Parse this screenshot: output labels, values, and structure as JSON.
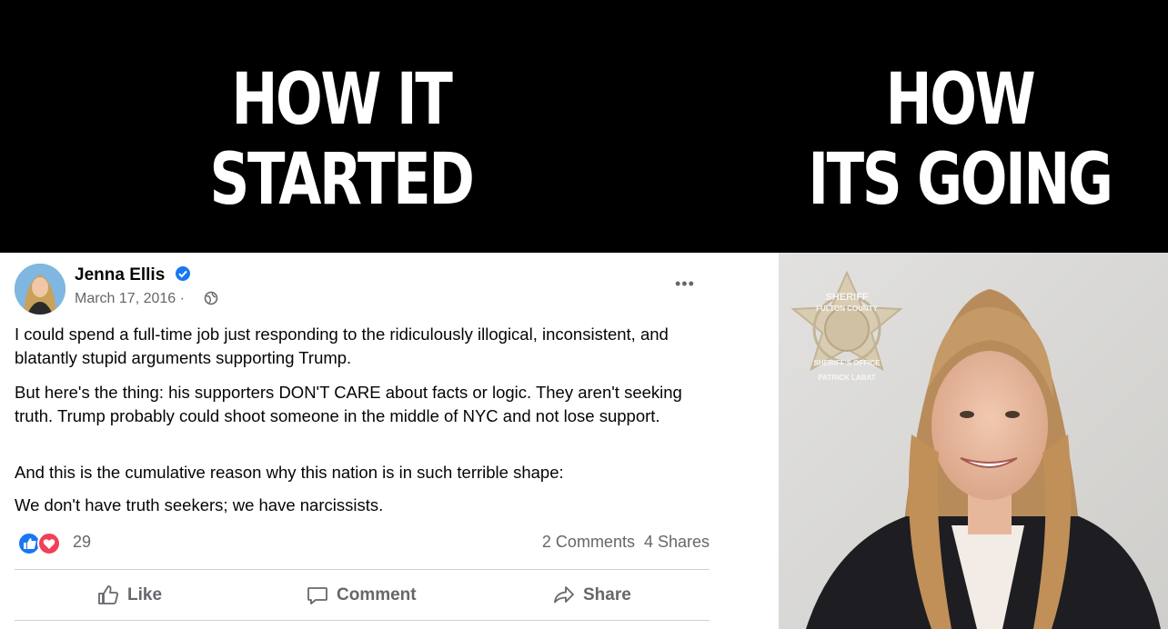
{
  "captions": {
    "left": [
      "HOW IT",
      "STARTED"
    ],
    "right": [
      "HOW",
      "ITS GOING"
    ]
  },
  "post": {
    "author": "Jenna Ellis",
    "date": "March 17, 2016 ·",
    "paragraphs": [
      "I could spend a full-time job just responding to the ridiculously illogical, inconsistent, and blatantly stupid arguments supporting Trump.",
      "But here's the thing: his supporters DON'T CARE about facts or logic. They aren't seeking truth. Trump probably could shoot someone in the middle of NYC and not lose support.",
      "And this is the cumulative reason why this nation is in such terrible shape:",
      "We don't have truth seekers; we have narcissists."
    ],
    "reaction_count": "29",
    "stats": "2 Comments  4 Shares",
    "actions": {
      "like": "Like",
      "comment": "Comment",
      "share": "Share"
    }
  },
  "badge": {
    "top": "SHERIFF",
    "ring": "FULTON COUNTY",
    "bottom": "SHERIFF'S OFFICE",
    "name": "PATRICK LABAT"
  },
  "colors": {
    "fb_blue": "#1877f2",
    "love_red": "#f33e58",
    "muted": "#65676b"
  },
  "icons": [
    "verified-icon",
    "globe-icon",
    "more-icon",
    "like-reaction-icon",
    "love-reaction-icon",
    "thumbs-up-icon",
    "comment-icon",
    "share-icon"
  ]
}
